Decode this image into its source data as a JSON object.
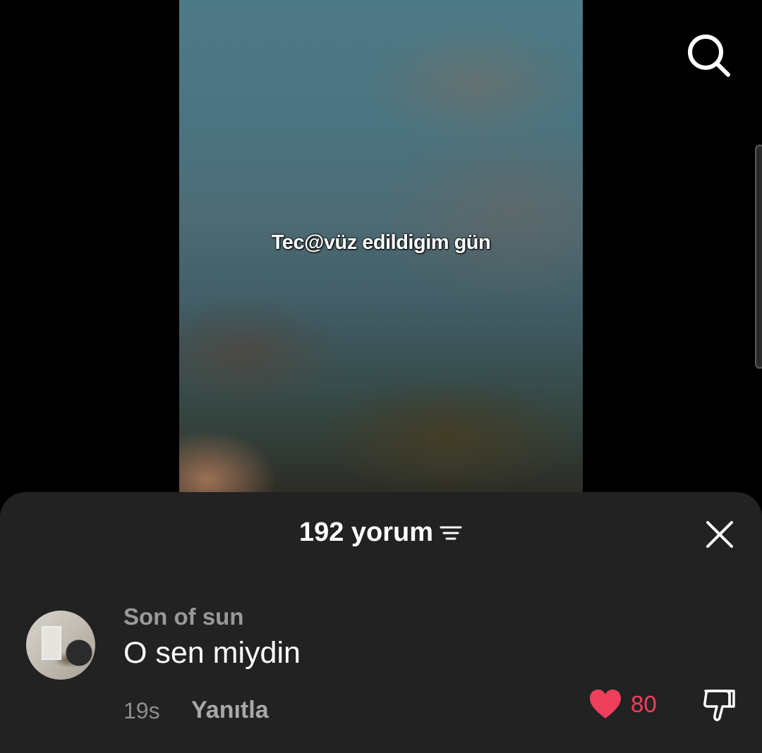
{
  "video": {
    "caption": "Tec@vüz edildigim gün"
  },
  "top_bar": {
    "search_icon": "search-icon"
  },
  "comments_sheet": {
    "header": {
      "count_label": "192 yorum",
      "sort_icon": "sort-icon",
      "close_icon": "close-icon"
    },
    "comments": [
      {
        "username": "Son of sun",
        "text": "O sen miydin",
        "time": "19s",
        "reply_label": "Yanıtla",
        "like_count": "80",
        "liked": true,
        "like_icon": "heart-icon",
        "dislike_icon": "thumbs-down-icon"
      }
    ]
  },
  "colors": {
    "sheet_background": "#222222",
    "like_active": "#ef3f5c",
    "secondary_text": "#9a9a9a"
  }
}
